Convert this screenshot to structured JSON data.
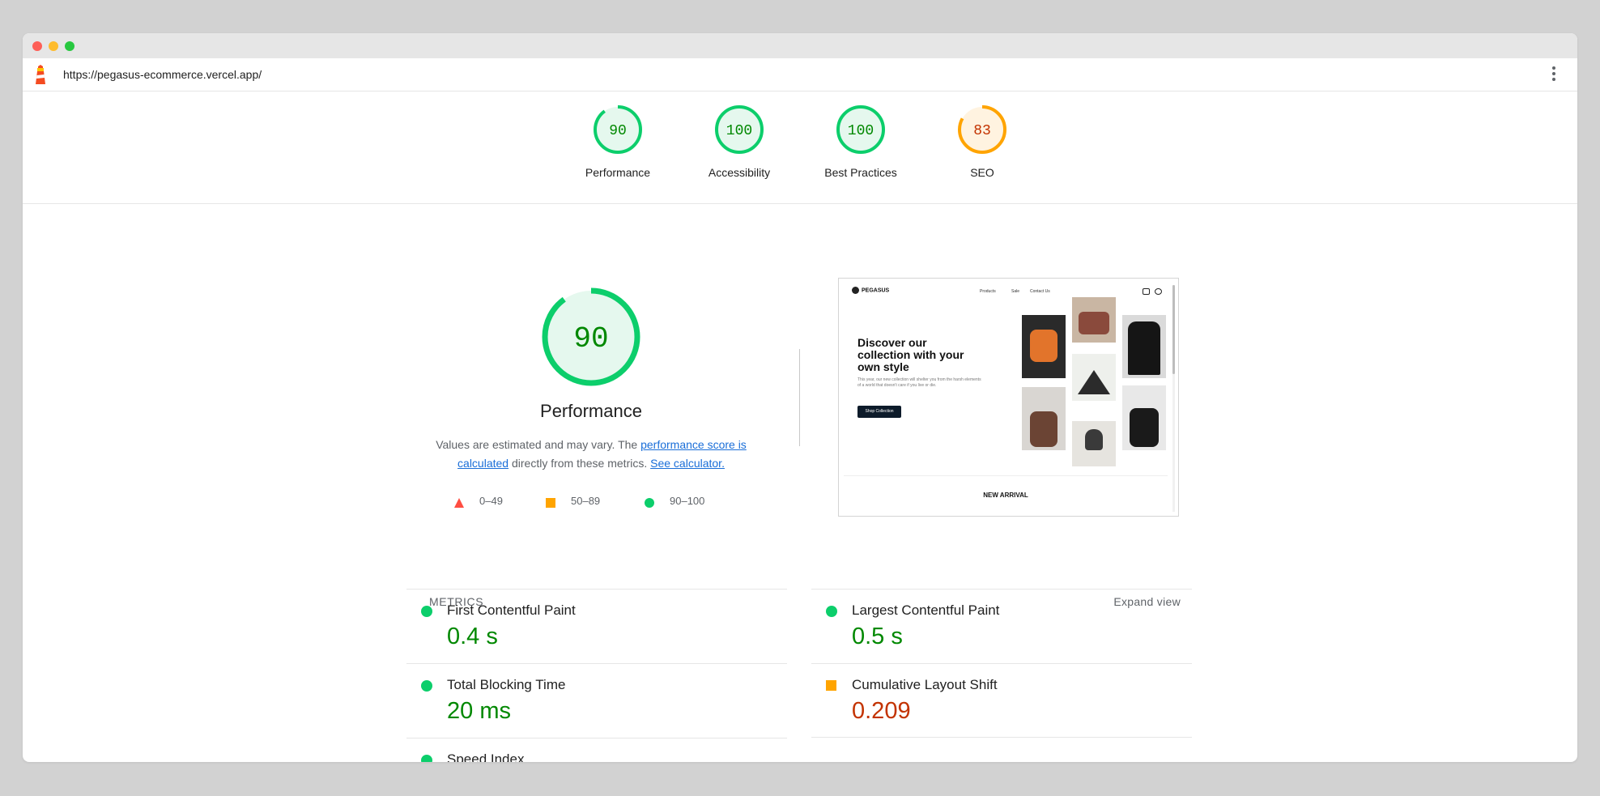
{
  "browser": {
    "url": "https://pegasus-ecommerce.vercel.app/"
  },
  "icons": {
    "logo": "lighthouse-logo-icon",
    "menu": "more-vertical-icon"
  },
  "colors": {
    "pass": "#0cce6b",
    "pass_text": "#008800",
    "average": "#ffa400",
    "average_text": "#c33300",
    "fail": "#ff4e42",
    "link": "#1a6ed8"
  },
  "scores": [
    {
      "label": "Performance",
      "value": "90",
      "score": 90,
      "rating": "pass"
    },
    {
      "label": "Accessibility",
      "value": "100",
      "score": 100,
      "rating": "pass"
    },
    {
      "label": "Best Practices",
      "value": "100",
      "score": 100,
      "rating": "pass"
    },
    {
      "label": "SEO",
      "value": "83",
      "score": 83,
      "rating": "average"
    }
  ],
  "performance": {
    "score_text": "90",
    "score": 90,
    "title": "Performance",
    "desc_start": "Values are estimated and may vary. The ",
    "desc_link1": "performance score is calculated",
    "desc_middle": " directly from these metrics. ",
    "desc_link2": "See calculator."
  },
  "legend": [
    {
      "range": "0–49",
      "shape": "triangle",
      "rating": "fail"
    },
    {
      "range": "50–89",
      "shape": "square",
      "rating": "average"
    },
    {
      "range": "90–100",
      "shape": "circle",
      "rating": "pass"
    }
  ],
  "screenshot": {
    "brand": "PEGASUS",
    "nav": [
      "Products",
      "Sale",
      "Contact Us"
    ],
    "headline": "Discover our collection with your own style",
    "subtext": "This year, our new collection will shelter you from the harsh elements of a world that doesn't care if you live or die.",
    "cta": "Shop Collection",
    "section_title": "NEW ARRIVAL"
  },
  "metrics": {
    "heading": "METRICS",
    "expand_label": "Expand view",
    "items": [
      {
        "title": "First Contentful Paint",
        "value": "0.4 s",
        "rating": "pass"
      },
      {
        "title": "Largest Contentful Paint",
        "value": "0.5 s",
        "rating": "pass"
      },
      {
        "title": "Total Blocking Time",
        "value": "20 ms",
        "rating": "pass"
      },
      {
        "title": "Cumulative Layout Shift",
        "value": "0.209",
        "rating": "average"
      },
      {
        "title": "Speed Index",
        "value": "",
        "rating": "pass"
      }
    ]
  }
}
